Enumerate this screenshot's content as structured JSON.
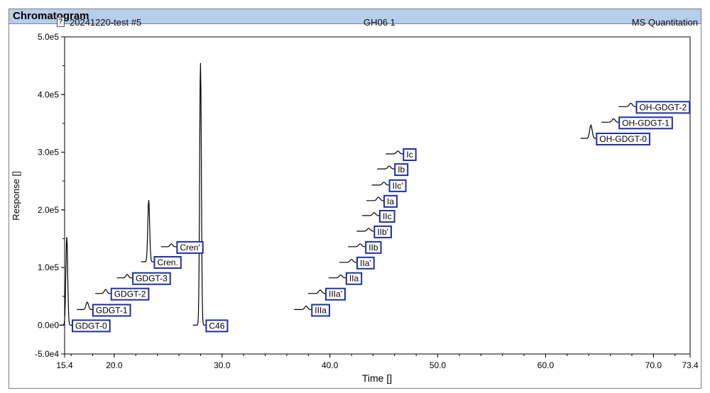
{
  "window": {
    "title": "Chromatogram",
    "sample_name": "20241220-test #5",
    "center_label": "GH06 1",
    "right_label": "MS Quantitation",
    "doc_icon": "document-help-icon"
  },
  "colors": {
    "title_bar": "#b7cdea",
    "trace": "#000000",
    "label_border": "#1f2fa8",
    "axis": "#000000"
  },
  "chart_data": {
    "type": "line",
    "xlabel": "Time []",
    "ylabel": "Response []",
    "xlim": [
      15.4,
      73.4
    ],
    "ylim": [
      -50000,
      500000
    ],
    "x_ticks": [
      {
        "v": 15.4,
        "label": "15.4"
      },
      {
        "v": 20.0,
        "label": "20.0"
      },
      {
        "v": 30.0,
        "label": "30.0"
      },
      {
        "v": 40.0,
        "label": "40.0"
      },
      {
        "v": 50.0,
        "label": "50.0"
      },
      {
        "v": 60.0,
        "label": "60.0"
      },
      {
        "v": 70.0,
        "label": "70.0"
      },
      {
        "v": 73.4,
        "label": "73.4"
      }
    ],
    "y_ticks": [
      {
        "v": 500000,
        "label": "5.0e5"
      },
      {
        "v": 400000,
        "label": "4.0e5"
      },
      {
        "v": 300000,
        "label": "3.0e5"
      },
      {
        "v": 200000,
        "label": "2.0e5"
      },
      {
        "v": 100000,
        "label": "1.0e5"
      },
      {
        "v": 0,
        "label": "0.0e0"
      },
      {
        "v": -50000,
        "label": "-5.0e4"
      }
    ],
    "grid": false,
    "peaks": [
      {
        "name": "GDGT-0",
        "x": 15.6,
        "baseline": 0,
        "apex": 153000,
        "width": 0.22,
        "label_y": 0
      },
      {
        "name": "GDGT-1",
        "x": 17.5,
        "baseline": 27000,
        "apex": 40000,
        "width": 0.3,
        "label_y": 27000
      },
      {
        "name": "GDGT-2",
        "x": 19.2,
        "baseline": 55000,
        "apex": 62000,
        "width": 0.3,
        "label_y": 55000
      },
      {
        "name": "GDGT-3",
        "x": 21.2,
        "baseline": 82000,
        "apex": 88000,
        "width": 0.3,
        "label_y": 82000
      },
      {
        "name": "Cren.",
        "x": 23.2,
        "baseline": 110000,
        "apex": 217000,
        "width": 0.22,
        "label_y": 110000
      },
      {
        "name": "Cren'",
        "x": 25.3,
        "baseline": 136000,
        "apex": 141000,
        "width": 0.3,
        "label_y": 136000
      },
      {
        "name": "C46",
        "x": 28.0,
        "baseline": 0,
        "apex": 455000,
        "width": 0.2,
        "label_y": 0
      },
      {
        "name": "IIIa",
        "x": 37.8,
        "baseline": 27000,
        "apex": 33000,
        "width": 0.35,
        "label_y": 27000
      },
      {
        "name": "IIIa'",
        "x": 39.1,
        "baseline": 55000,
        "apex": 61000,
        "width": 0.35,
        "label_y": 55000
      },
      {
        "name": "IIa",
        "x": 41.0,
        "baseline": 82000,
        "apex": 87000,
        "width": 0.35,
        "label_y": 82000
      },
      {
        "name": "IIa'",
        "x": 42.0,
        "baseline": 109000,
        "apex": 114000,
        "width": 0.35,
        "label_y": 109000
      },
      {
        "name": "IIb",
        "x": 42.8,
        "baseline": 136000,
        "apex": 141000,
        "width": 0.35,
        "label_y": 136000
      },
      {
        "name": "IIb'",
        "x": 43.6,
        "baseline": 163000,
        "apex": 168000,
        "width": 0.35,
        "label_y": 163000
      },
      {
        "name": "IIc",
        "x": 44.1,
        "baseline": 190000,
        "apex": 195000,
        "width": 0.35,
        "label_y": 190000
      },
      {
        "name": "Ia",
        "x": 44.5,
        "baseline": 216000,
        "apex": 222000,
        "width": 0.35,
        "label_y": 216000
      },
      {
        "name": "IIc'",
        "x": 45.0,
        "baseline": 243000,
        "apex": 248000,
        "width": 0.35,
        "label_y": 243000
      },
      {
        "name": "Ib",
        "x": 45.5,
        "baseline": 271000,
        "apex": 276000,
        "width": 0.35,
        "label_y": 271000
      },
      {
        "name": "Ic",
        "x": 46.3,
        "baseline": 297000,
        "apex": 302000,
        "width": 0.35,
        "label_y": 297000
      },
      {
        "name": "OH-GDGT-0",
        "x": 64.2,
        "baseline": 324000,
        "apex": 347000,
        "width": 0.3,
        "label_y": 324000
      },
      {
        "name": "OH-GDGT-1",
        "x": 66.3,
        "baseline": 352000,
        "apex": 358000,
        "width": 0.35,
        "label_y": 352000
      },
      {
        "name": "OH-GDGT-2",
        "x": 67.9,
        "baseline": 379000,
        "apex": 385000,
        "width": 0.35,
        "label_y": 379000
      }
    ]
  }
}
